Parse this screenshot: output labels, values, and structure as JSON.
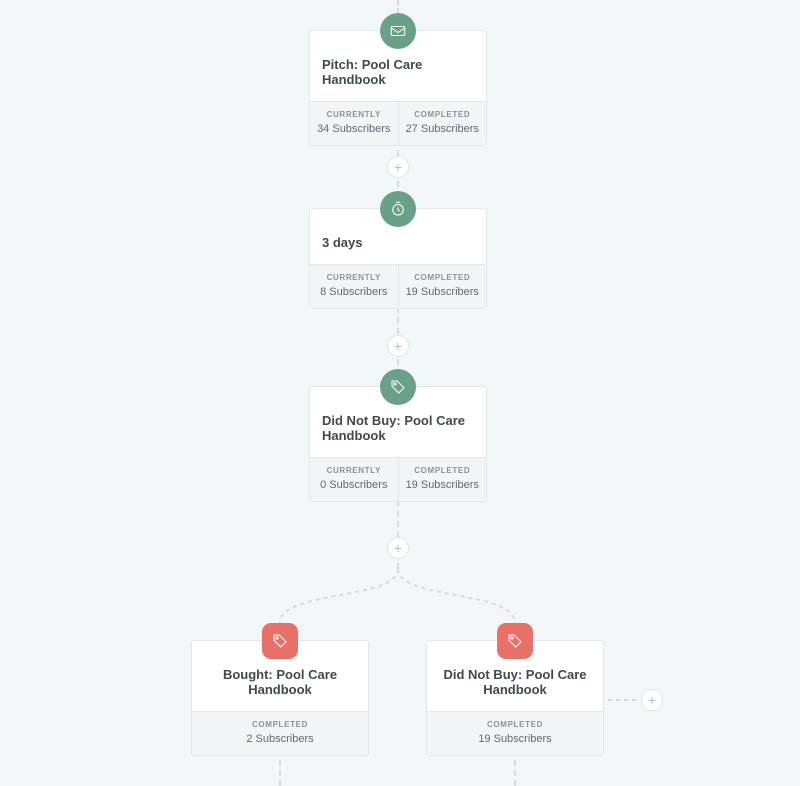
{
  "colors": {
    "green": "#68a088",
    "red": "#e87067"
  },
  "labels": {
    "currently": "CURRENTLY",
    "completed": "COMPLETED"
  },
  "nodes": [
    {
      "id": "pitch",
      "title": "Pitch: Pool Care Handbook",
      "icon": "mail-icon",
      "badgeColor": "green",
      "currently": "34 Subscribers",
      "completed": "27 Subscribers",
      "titleAlign": "left",
      "statsMode": "both"
    },
    {
      "id": "wait",
      "title": "3 days",
      "icon": "clock-icon",
      "badgeColor": "green",
      "currently": "8 Subscribers",
      "completed": "19 Subscribers",
      "titleAlign": "left",
      "statsMode": "both"
    },
    {
      "id": "dnb1",
      "title": "Did Not Buy: Pool Care Handbook",
      "icon": "tag-icon",
      "badgeColor": "green",
      "currently": "0 Subscribers",
      "completed": "19 Subscribers",
      "titleAlign": "left",
      "statsMode": "both"
    },
    {
      "id": "bought",
      "title": "Bought: Pool Care Handbook",
      "icon": "tag-icon",
      "badgeColor": "red",
      "completed": "2 Subscribers",
      "titleAlign": "center",
      "statsMode": "completed"
    },
    {
      "id": "dnb2",
      "title": "Did Not Buy: Pool Care Handbook",
      "icon": "tag-icon",
      "badgeColor": "red",
      "completed": "19 Subscribers",
      "titleAlign": "center",
      "statsMode": "completed"
    }
  ]
}
